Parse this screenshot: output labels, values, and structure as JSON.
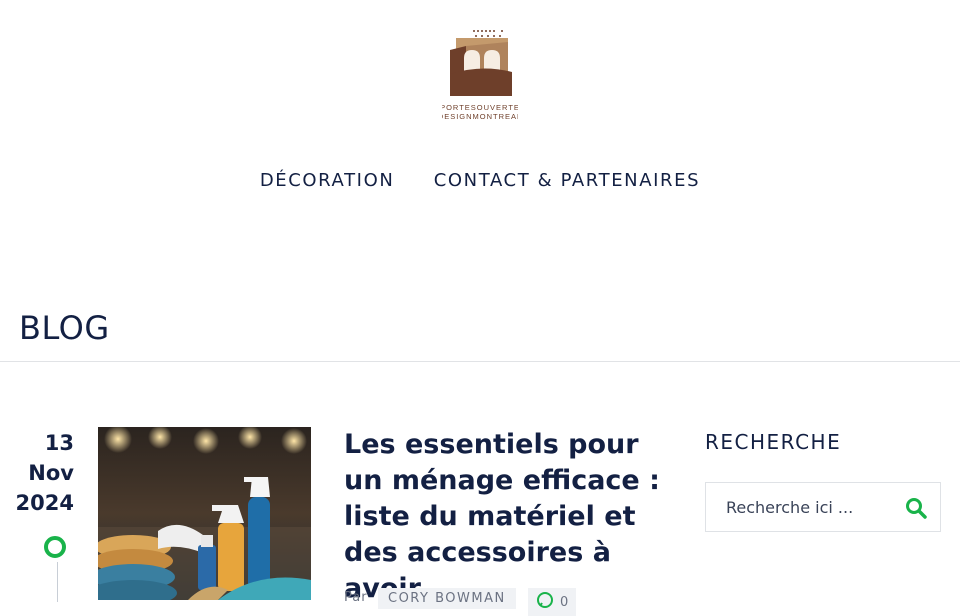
{
  "site": {
    "logo_text_line1": "PORTESOUVERTE",
    "logo_text_line2": "DESIGNMONTREAL"
  },
  "nav": {
    "items": [
      {
        "label": "DÉCORATION"
      },
      {
        "label": "CONTACT & PARTENAIRES"
      }
    ]
  },
  "page": {
    "title": "BLOG"
  },
  "post": {
    "date_day": "13",
    "date_month": "Nov",
    "date_year": "2024",
    "title": "Les essentiels pour un ménage efficace : liste du matériel et des accessoires à avoir",
    "by_label": "Par",
    "author": "CORY BOWMAN",
    "comment_count": "0"
  },
  "sidebar": {
    "search_title": "RECHERCHE",
    "search_placeholder": "Recherche ici ..."
  },
  "colors": {
    "accent": "#19b34a",
    "navy": "#132043",
    "logo_brown": "#6e3f2a",
    "logo_tan": "#c49a6c"
  }
}
